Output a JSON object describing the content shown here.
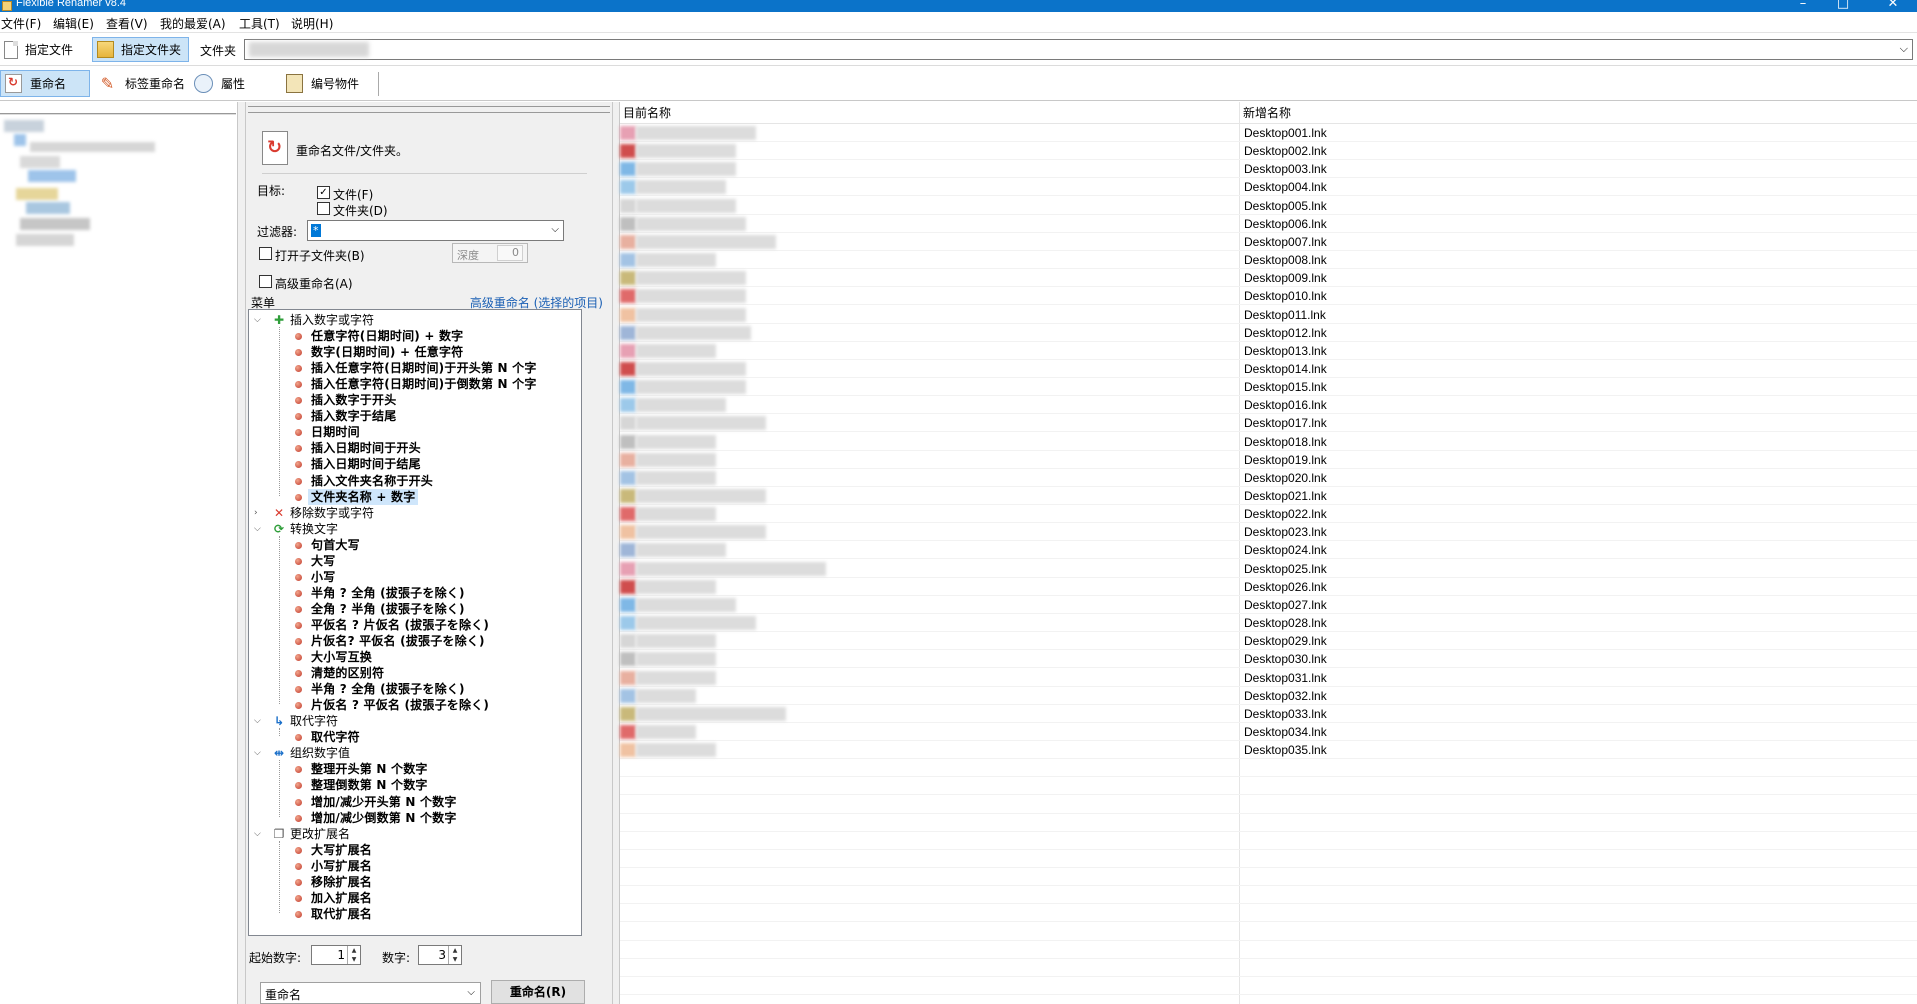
{
  "window": {
    "title": "Flexible Renamer v8.4"
  },
  "menu": [
    "文件(F)",
    "编辑(E)",
    "查看(V)",
    "我的最爱(A)",
    "工具(T)",
    "说明(H)"
  ],
  "toolbar1": {
    "specify_files": "指定文件",
    "specify_folder": "指定文件夹",
    "folder_label": "文件夹"
  },
  "toolbar2": {
    "rename": "重命名",
    "tag_rename": "标签重命名",
    "properties": "屬性",
    "numbering": "编号物件"
  },
  "panel": {
    "title": "重命名文件/文件夹。",
    "target_label": "目标:",
    "target_file": "文件(F)",
    "target_file_checked": true,
    "target_folder": "文件夹(D)",
    "target_folder_checked": false,
    "filter_label": "过滤器:",
    "filter_value": "*",
    "open_subfolders": "打开子文件夹(B)",
    "depth_label": "深度",
    "depth_value": "0",
    "advanced_rename": "高级重命名(A)",
    "menu_label": "菜单",
    "advanced_link": "高级重命名 (选择的项目)",
    "start_label": "起始数字:",
    "start_value": "1",
    "digits_label": "数字:",
    "digits_value": "3",
    "mode_value": "重命名",
    "rename_button": "重命名(R)"
  },
  "tree": [
    {
      "label": "插入数字或字符",
      "icon": "plus-icon",
      "color": "#2f9e3a",
      "expanded": true,
      "items": [
        "任意字符(日期时间) + 数字",
        "数字(日期时间) + 任意字符",
        "插入任意字符(日期时间)于开头第 N 个字",
        "插入任意字符(日期时间)于倒数第 N 个字",
        "插入数字于开头",
        "插入数字于结尾",
        "日期时间",
        "插入日期时间于开头",
        "插入日期时间于结尾",
        "插入文件夹名称于开头",
        "文件夹名称 + 数字"
      ]
    },
    {
      "label": "移除数字或字符",
      "icon": "cross-icon",
      "color": "#d93b2f",
      "expanded": false,
      "items": []
    },
    {
      "label": "转换文字",
      "icon": "cycle-icon",
      "color": "#2f9e3a",
      "expanded": true,
      "items": [
        "句首大写",
        "大写",
        "小写",
        "半角 ? 全角 (拔張子を除く)",
        "全角 ? 半角 (拔張子を除く)",
        "平仮名 ? 片仮名 (拔張子を除く)",
        "片仮名? 平仮名 (拔張子を除く)",
        "大小写互换",
        "清楚的区别符",
        "半角 ? 全角 (拔張子を除く)",
        "片仮名 ? 平仮名 (拔張子を除く)"
      ]
    },
    {
      "label": "取代字符",
      "icon": "replace-arrow-icon",
      "color": "#1a6fc9",
      "expanded": true,
      "items": [
        "取代字符"
      ]
    },
    {
      "label": "组织数字值",
      "icon": "arrows-icon",
      "color": "#1a6fc9",
      "expanded": true,
      "items": [
        "整理开头第 N 个数字",
        "整理倒数第 N 个数字",
        "增加/减少开头第 N 个数字",
        "增加/减少倒数第 N 个数字"
      ]
    },
    {
      "label": "更改扩展名",
      "icon": "doc-icon",
      "color": "#555555",
      "expanded": true,
      "items": [
        "大写扩展名",
        "小写扩展名",
        "移除扩展名",
        "加入扩展名",
        "取代扩展名"
      ]
    }
  ],
  "list": {
    "col_current": "目前名称",
    "col_new": "新增名称",
    "new_names": [
      "Desktop001.lnk",
      "Desktop002.lnk",
      "Desktop003.lnk",
      "Desktop004.lnk",
      "Desktop005.lnk",
      "Desktop006.lnk",
      "Desktop007.lnk",
      "Desktop008.lnk",
      "Desktop009.lnk",
      "Desktop010.lnk",
      "Desktop011.lnk",
      "Desktop012.lnk",
      "Desktop013.lnk",
      "Desktop014.lnk",
      "Desktop015.lnk",
      "Desktop016.lnk",
      "Desktop017.lnk",
      "Desktop018.lnk",
      "Desktop019.lnk",
      "Desktop020.lnk",
      "Desktop021.lnk",
      "Desktop022.lnk",
      "Desktop023.lnk",
      "Desktop024.lnk",
      "Desktop025.lnk",
      "Desktop026.lnk",
      "Desktop027.lnk",
      "Desktop028.lnk",
      "Desktop029.lnk",
      "Desktop030.lnk",
      "Desktop031.lnk",
      "Desktop032.lnk",
      "Desktop033.lnk",
      "Desktop034.lnk",
      "Desktop035.lnk"
    ]
  },
  "colors": {
    "titlebar": "#0b73c9",
    "selection": "#cce4f7",
    "link": "#1a5fb4",
    "bullet": "#c0392b"
  }
}
